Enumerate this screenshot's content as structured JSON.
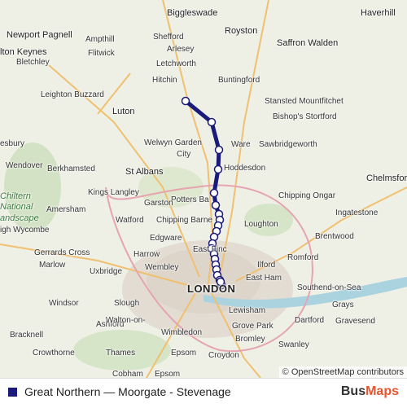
{
  "map": {
    "places": [
      {
        "label": "Biggleswade",
        "cls": "big"
      },
      {
        "label": "Haverhill",
        "cls": "big"
      },
      {
        "label": "Newport Pagnell",
        "cls": "big"
      },
      {
        "label": "Shefford",
        "cls": ""
      },
      {
        "label": "Royston",
        "cls": "big"
      },
      {
        "label": "Ampthill",
        "cls": ""
      },
      {
        "label": "Saffron Walden",
        "cls": "big"
      },
      {
        "label": "lton Keynes",
        "cls": "big"
      },
      {
        "label": "Flitwick",
        "cls": ""
      },
      {
        "label": "Arlesey",
        "cls": ""
      },
      {
        "label": "Letchworth",
        "cls": ""
      },
      {
        "label": "Bletchley",
        "cls": ""
      },
      {
        "label": "Hitchin",
        "cls": ""
      },
      {
        "label": "Buntingford",
        "cls": ""
      },
      {
        "label": "Leighton Buzzard",
        "cls": ""
      },
      {
        "label": "Stansted Mountfitchet",
        "cls": ""
      },
      {
        "label": "Luton",
        "cls": "big"
      },
      {
        "label": "Bishop's Stortford",
        "cls": ""
      },
      {
        "label": "esbury",
        "cls": ""
      },
      {
        "label": "Welwyn Garden",
        "cls": ""
      },
      {
        "label": "City",
        "cls": ""
      },
      {
        "label": "Ware",
        "cls": ""
      },
      {
        "label": "Sawbridgeworth",
        "cls": ""
      },
      {
        "label": "Wendover",
        "cls": ""
      },
      {
        "label": "Berkhamsted",
        "cls": ""
      },
      {
        "label": "Hoddesdon",
        "cls": ""
      },
      {
        "label": "St Albans",
        "cls": "big"
      },
      {
        "label": "Chelmsford",
        "cls": "big"
      },
      {
        "label": "Chiltern",
        "cls": "park"
      },
      {
        "label": "Kings Langley",
        "cls": ""
      },
      {
        "label": "National",
        "cls": "park"
      },
      {
        "label": "Potters Ba",
        "cls": ""
      },
      {
        "label": "Chipping Ongar",
        "cls": ""
      },
      {
        "label": "Amersham",
        "cls": ""
      },
      {
        "label": "Garston",
        "cls": ""
      },
      {
        "label": "Ingatestone",
        "cls": ""
      },
      {
        "label": "andscape",
        "cls": "park"
      },
      {
        "label": "Watford",
        "cls": ""
      },
      {
        "label": "Chipping Barne",
        "cls": ""
      },
      {
        "label": "Loughton",
        "cls": ""
      },
      {
        "label": "igh Wycombe",
        "cls": ""
      },
      {
        "label": "Edgware",
        "cls": ""
      },
      {
        "label": "Brentwood",
        "cls": ""
      },
      {
        "label": "Gerrards Cross",
        "cls": ""
      },
      {
        "label": "Harrow",
        "cls": ""
      },
      {
        "label": "East Finc",
        "cls": ""
      },
      {
        "label": "Romford",
        "cls": ""
      },
      {
        "label": "Marlow",
        "cls": ""
      },
      {
        "label": "Uxbridge",
        "cls": ""
      },
      {
        "label": "Wembley",
        "cls": ""
      },
      {
        "label": "Ilford",
        "cls": ""
      },
      {
        "label": "East Ham",
        "cls": ""
      },
      {
        "label": "LONDON",
        "cls": "city"
      },
      {
        "label": "Southend-on-Sea",
        "cls": ""
      },
      {
        "label": "Windsor",
        "cls": ""
      },
      {
        "label": "Slough",
        "cls": ""
      },
      {
        "label": "Lewisham",
        "cls": ""
      },
      {
        "label": "Grays",
        "cls": ""
      },
      {
        "label": "Ashford",
        "cls": ""
      },
      {
        "label": "Grove Park",
        "cls": ""
      },
      {
        "label": "Dartford",
        "cls": ""
      },
      {
        "label": "Gravesend",
        "cls": ""
      },
      {
        "label": "Bracknell",
        "cls": ""
      },
      {
        "label": "Wimbledon",
        "cls": ""
      },
      {
        "label": "Bromley",
        "cls": ""
      },
      {
        "label": "Walton-on-",
        "cls": ""
      },
      {
        "label": "Thames",
        "cls": ""
      },
      {
        "label": "Swanley",
        "cls": ""
      },
      {
        "label": "Crowthorne",
        "cls": ""
      },
      {
        "label": "Epsom",
        "cls": ""
      },
      {
        "label": "Croydon",
        "cls": ""
      },
      {
        "label": "Cobham",
        "cls": ""
      },
      {
        "label": "Epsom",
        "cls": ""
      }
    ],
    "attribution": "© OpenStreetMap contributors"
  },
  "legend": {
    "route_name": "Great Northern — Moorgate - Stevenage",
    "route_color": "#1a1a7a",
    "brand_part1": "Bus",
    "brand_part2": "Maps"
  }
}
